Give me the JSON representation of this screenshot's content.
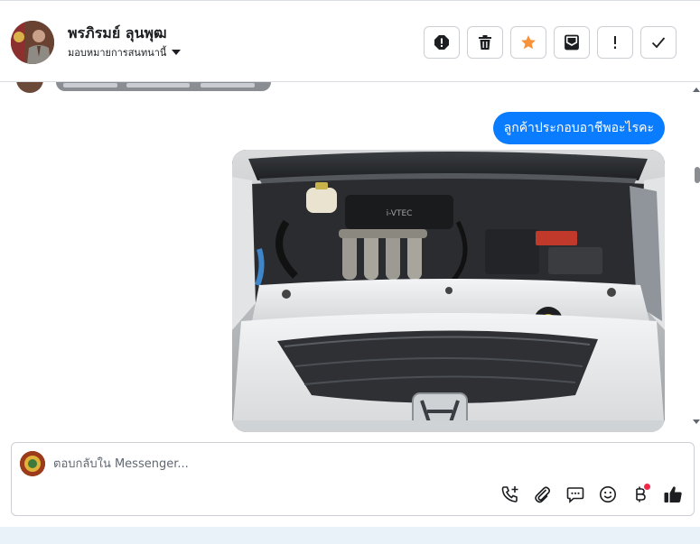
{
  "header": {
    "contact_name": "พรภิรมย์ ลุนพุฒ",
    "assign_label": "มอบหมายการสนทนานี้",
    "toolbar": [
      {
        "name": "alert-circle-button",
        "icon": "alert-circle-icon"
      },
      {
        "name": "delete-button",
        "icon": "trash-icon"
      },
      {
        "name": "star-button",
        "icon": "star-icon"
      },
      {
        "name": "mark-unread-button",
        "icon": "envelope-icon"
      },
      {
        "name": "follow-up-button",
        "icon": "exclamation-icon"
      },
      {
        "name": "mark-done-button",
        "icon": "check-icon"
      }
    ]
  },
  "thread": {
    "message_text": "ลูกค้าประกอบอาชีพอะไรคะ",
    "attachment": "car-engine-photo"
  },
  "composer": {
    "placeholder": "ตอบกลับใน Messenger...",
    "actions": [
      "phone-add-icon",
      "paperclip-icon",
      "chat-bubble-icon",
      "smiley-icon",
      "baht-icon",
      "thumbs-up-icon"
    ]
  },
  "colors": {
    "accent": "#0a7cff",
    "star": "#f7923a",
    "badge": "#f02849"
  }
}
